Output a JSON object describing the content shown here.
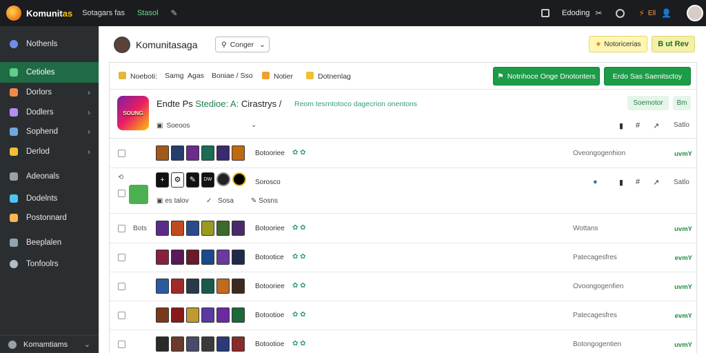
{
  "topbar": {
    "brand_a": "Komunit",
    "brand_b": "as",
    "nav1": "Sotagars fas",
    "nav2": "Stasol",
    "right_label": "Edoding",
    "right_small": "Ell"
  },
  "sidebar": {
    "items": [
      {
        "label": "Nothenls",
        "color": "#6f8de8"
      },
      {
        "label": "Cetioles",
        "color": "#5fd08a"
      },
      {
        "label": "Dorlors",
        "color": "#f08a4b"
      },
      {
        "label": "Dodlers",
        "color": "#b28ef0"
      },
      {
        "label": "Sophend",
        "color": "#6fa8dc"
      },
      {
        "label": "Derlod",
        "color": "#f2c037"
      },
      {
        "label": "Adeonals",
        "color": "#9aa0a6"
      },
      {
        "label": "Dodelnts",
        "color": "#4fc3f7"
      },
      {
        "label": "Postonnard",
        "color": "#ffb74d"
      },
      {
        "label": "Beeplalen",
        "color": "#90a4ae"
      },
      {
        "label": "Tonfoolrs",
        "color": "#b0bec5"
      }
    ],
    "bottom_label": "Komamtiams"
  },
  "header": {
    "title": "Komunitasaga",
    "category_label": "Conger",
    "notif_label": "Notoricerias",
    "new_label": "B ut Rev"
  },
  "toolbar": {
    "filter1": "Noeboti:",
    "filter2": "Samg",
    "filter3": "Agas",
    "filter4": "Boniae / Sso",
    "filter5": "Notier",
    "filter6": "Dotnenlag",
    "btn1": "Notnhoce Onge Dnotonters",
    "btn2": "Erdo Sas Saenitsctoy"
  },
  "feature": {
    "badge_text": "SOUNG",
    "title_a": "Endte Ps",
    "title_b": "Stedioe: A:",
    "title_c": "Cirastrys /",
    "subtitle": "Reom tesrntotoco dagecrion onentons",
    "control": "Soeoos",
    "pill1": "Soemotor",
    "pill2": "Bm",
    "action_label": "Satlo"
  },
  "rows": [
    {
      "label": "Botooriee",
      "status": "Oveongogenhion",
      "version": "uvmY",
      "colors": [
        "#a05a1a",
        "#263e6b",
        "#6a2b8c",
        "#1b6b55",
        "#3a2a6e",
        "#c06a10"
      ]
    },
    {
      "label": "Botooriee",
      "status": "Wottans",
      "version": "uvmY",
      "extra": "Bots",
      "colors": [
        "#5a2b8c",
        "#c04a20",
        "#2a4a8c",
        "#9a9a20",
        "#3a6b2a",
        "#4a2a6a"
      ]
    },
    {
      "label": "Botootice",
      "status": "Patecagesfres",
      "version": "evmY",
      "colors": [
        "#8a2040",
        "#5a1a5a",
        "#6a1a2a",
        "#1a4a8a",
        "#6a3aa0",
        "#202a4a"
      ]
    },
    {
      "label": "Botooriee",
      "status": "Ovoongogenfien",
      "version": "uvmY",
      "colors": [
        "#2a5aa0",
        "#a02a2a",
        "#2a3a4a",
        "#1a5a4a",
        "#c06a20",
        "#3a2a20"
      ]
    },
    {
      "label": "Botootioe",
      "status": "Patecagesfres",
      "version": "evmY",
      "colors": [
        "#7a3a1a",
        "#8a1a1a",
        "#c09a30",
        "#5a3aa0",
        "#6a2aa0",
        "#1a6a3a"
      ]
    },
    {
      "label": "Botootioe",
      "status": "Botongogentien",
      "version": "uvmY",
      "colors": [
        "#2a2a2a",
        "#6a3a2a",
        "#4a4a6a",
        "#3a3a3a",
        "#2a3a7a",
        "#8a2a2a"
      ]
    }
  ],
  "detail_row": {
    "label": "Sorosco",
    "meta1": "es talov",
    "meta2": "Sosa",
    "meta3": "Sosns",
    "action_label": "Satlo"
  }
}
